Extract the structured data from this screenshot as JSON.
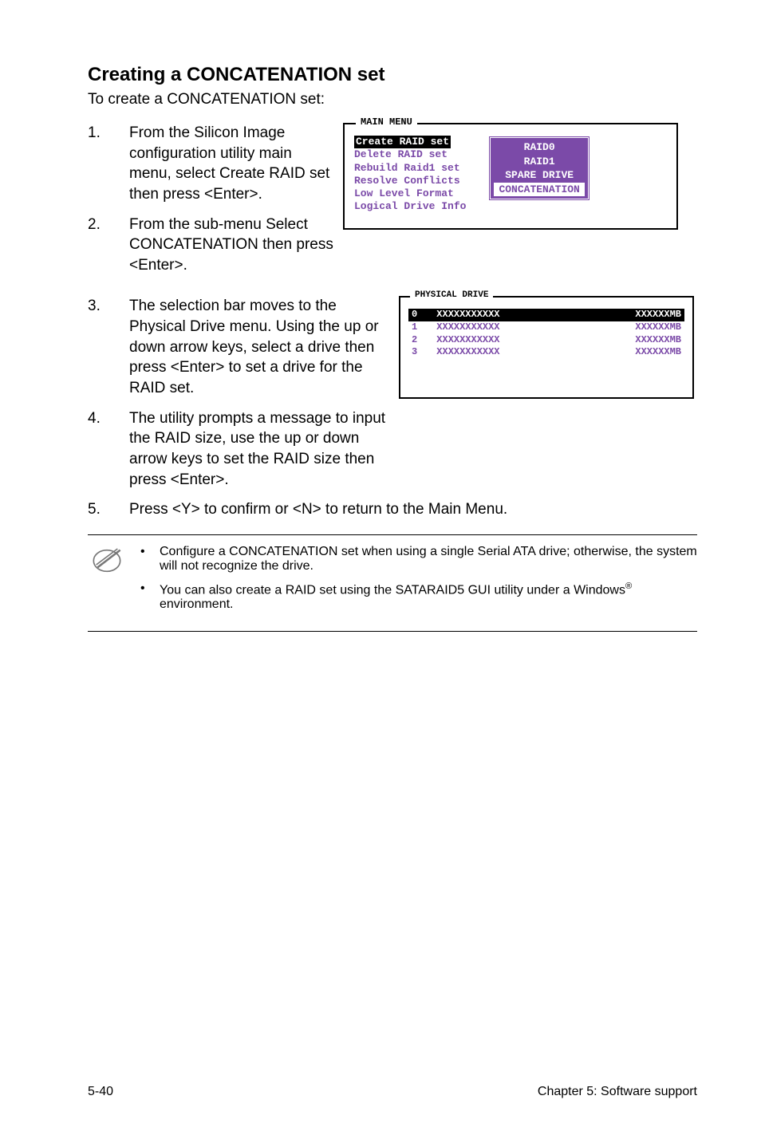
{
  "heading": "Creating a CONCATENATION set",
  "intro": "To create a CONCATENATION set:",
  "steps": {
    "s1": {
      "num": "1.",
      "text": "From the Silicon Image configuration utility main menu, select Create RAID set then press <Enter>."
    },
    "s2": {
      "num": "2.",
      "text": "From the sub-menu Select CONCATENATION then press <Enter>."
    },
    "s3": {
      "num": "3.",
      "text": "The selection bar moves to the Physical Drive menu. Using the up or down arrow keys, select a drive then press <Enter> to set a drive for the RAID set."
    },
    "s4": {
      "num": "4.",
      "text": "The utility prompts a message to input the RAID size, use the up or down arrow keys to set the RAID size then press <Enter>."
    },
    "s5": {
      "num": "5.",
      "text": "Press <Y> to confirm or <N> to return to the Main Menu."
    }
  },
  "bios1": {
    "title": "MAIN MENU",
    "items": {
      "i0": "Create RAID set",
      "i1": "Delete RAID set",
      "i2": "Rebuild Raid1 set",
      "i3": "Resolve Conflicts",
      "i4": "Low Level Format",
      "i5": "Logical Drive Info"
    },
    "sub": {
      "o0": "RAID0",
      "o1": "RAID1",
      "o2": "SPARE DRIVE",
      "o3": "CONCATENATION"
    }
  },
  "bios2": {
    "title": "PHYSICAL DRIVE",
    "rows": {
      "r0": {
        "idx": "0",
        "name": "XXXXXXXXXXX",
        "size": "XXXXXXMB"
      },
      "r1": {
        "idx": "1",
        "name": "XXXXXXXXXXX",
        "size": "XXXXXXMB"
      },
      "r2": {
        "idx": "2",
        "name": "XXXXXXXXXXX",
        "size": "XXXXXXMB"
      },
      "r3": {
        "idx": "3",
        "name": "XXXXXXXXXXX",
        "size": "XXXXXXMB"
      }
    }
  },
  "notes": {
    "n1": "Configure a CONCATENATION set when using a single Serial ATA drive; otherwise, the system will not recognize the drive.",
    "n2a": "You can also create a RAID set using the SATARAID5 GUI utility under a Windows",
    "n2b": " environment."
  },
  "footer": {
    "left": "5-40",
    "right": "Chapter 5: Software support"
  }
}
